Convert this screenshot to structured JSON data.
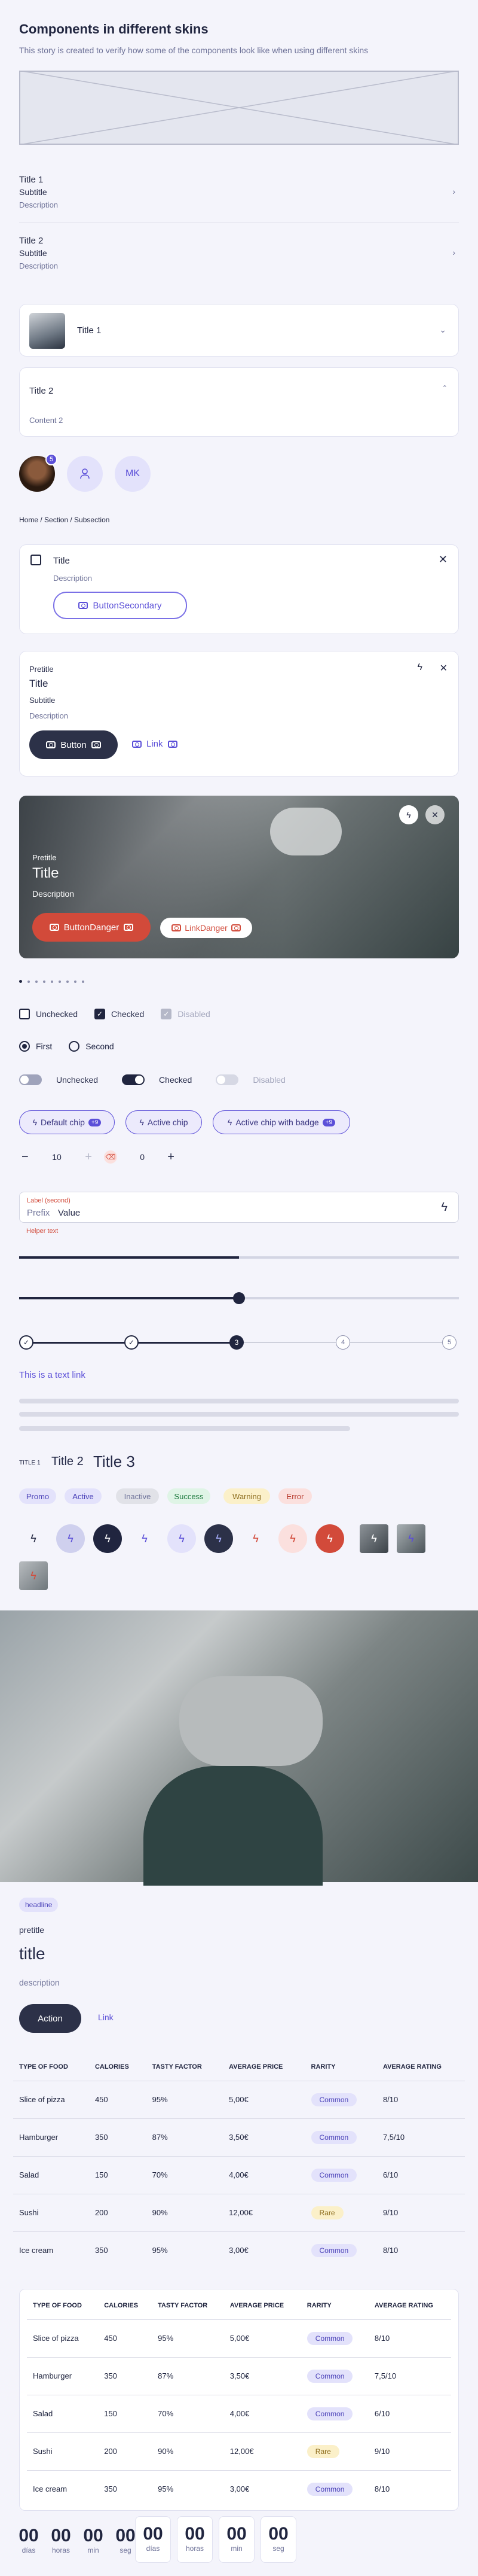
{
  "title": "Components in different skins",
  "description": "This story is created to verify how some of the components look like when using different skins",
  "list_rows": [
    {
      "title": "Title 1",
      "subtitle": "Subtitle",
      "description": "Description"
    },
    {
      "title": "Title 2",
      "subtitle": "Subtitle",
      "description": "Description"
    }
  ],
  "accordion": {
    "item1_title": "Title 1",
    "item2_title": "Title 2",
    "item2_content": "Content 2"
  },
  "avatars": {
    "badge": "5",
    "initials": "MK"
  },
  "breadcrumb": "Home / Section / Subsection",
  "card1": {
    "title": "Title",
    "description": "Description",
    "button": "ButtonSecondary"
  },
  "card2": {
    "pretitle": "Pretitle",
    "title": "Title",
    "subtitle": "Subtitle",
    "description": "Description",
    "button": "Button",
    "link": "Link"
  },
  "hero": {
    "pretitle": "Pretitle",
    "title": "Title",
    "description": "Description",
    "button": "ButtonDanger",
    "link": "LinkDanger"
  },
  "checkboxes": [
    {
      "label": "Unchecked",
      "checked": false
    },
    {
      "label": "Checked",
      "checked": true
    },
    {
      "label": "Disabled",
      "checked": true,
      "disabled": true
    }
  ],
  "radios": [
    {
      "label": "First",
      "checked": true
    },
    {
      "label": "Second",
      "checked": false
    }
  ],
  "switches": [
    {
      "label": "Unchecked"
    },
    {
      "label": "Checked"
    },
    {
      "label": "Disabled"
    }
  ],
  "chips": [
    {
      "label": "Default chip",
      "badge": "+9"
    },
    {
      "label": "Active chip"
    },
    {
      "label": "Active chip with badge",
      "badge": "+9"
    }
  ],
  "steppers": [
    {
      "value": "10"
    },
    {
      "value": "0"
    }
  ],
  "field": {
    "label": "Label (second)",
    "prefix": "Prefix",
    "value": "Value",
    "helper": "Helper text"
  },
  "slider_values": [
    0.5,
    0.5
  ],
  "progress_stepper": {
    "current": 3,
    "steps": [
      "1",
      "2",
      "3",
      "4",
      "5"
    ]
  },
  "text_link": "This is a text link",
  "texts": {
    "t1": "TITLE 1",
    "t2": "Title 2",
    "t3": "Title 3"
  },
  "tags": [
    {
      "label": "Promo",
      "bg": "#e3e2fb",
      "fg": "#4a41b8"
    },
    {
      "label": "Active",
      "bg": "#e3e2fb",
      "fg": "#4a41b8"
    },
    {
      "label": "Inactive",
      "bg": "#e1e2e8",
      "fg": "#6f7399"
    },
    {
      "label": "Success",
      "bg": "#dff4e6",
      "fg": "#1e7a3f"
    },
    {
      "label": "Warning",
      "bg": "#fbf0c9",
      "fg": "#8a6a1a"
    },
    {
      "label": "Error",
      "bg": "#fbe0de",
      "fg": "#b83b2e"
    }
  ],
  "highlight": {
    "headline": "headline",
    "pretitle": "pretitle",
    "title": "title",
    "description": "description",
    "button": "Action",
    "link": "Link"
  },
  "table": {
    "headers": [
      "TYPE OF FOOD",
      "CALORIES",
      "TASTY FACTOR",
      "AVERAGE PRICE",
      "RARITY",
      "AVERAGE RATING"
    ],
    "rows": [
      [
        "Slice of pizza",
        "450",
        "95%",
        "5,00€",
        "Common",
        "8/10"
      ],
      [
        "Hamburger",
        "350",
        "87%",
        "3,50€",
        "Common",
        "7,5/10"
      ],
      [
        "Salad",
        "150",
        "70%",
        "4,00€",
        "Common",
        "6/10"
      ],
      [
        "Sushi",
        "200",
        "90%",
        "12,00€",
        "Rare",
        "9/10"
      ],
      [
        "Ice cream",
        "350",
        "95%",
        "3,00€",
        "Common",
        "8/10"
      ]
    ]
  },
  "countdown": [
    {
      "num": "00",
      "label": "días"
    },
    {
      "num": "00",
      "label": "horas"
    },
    {
      "num": "00",
      "label": "min"
    },
    {
      "num": "00",
      "label": "seg"
    }
  ]
}
